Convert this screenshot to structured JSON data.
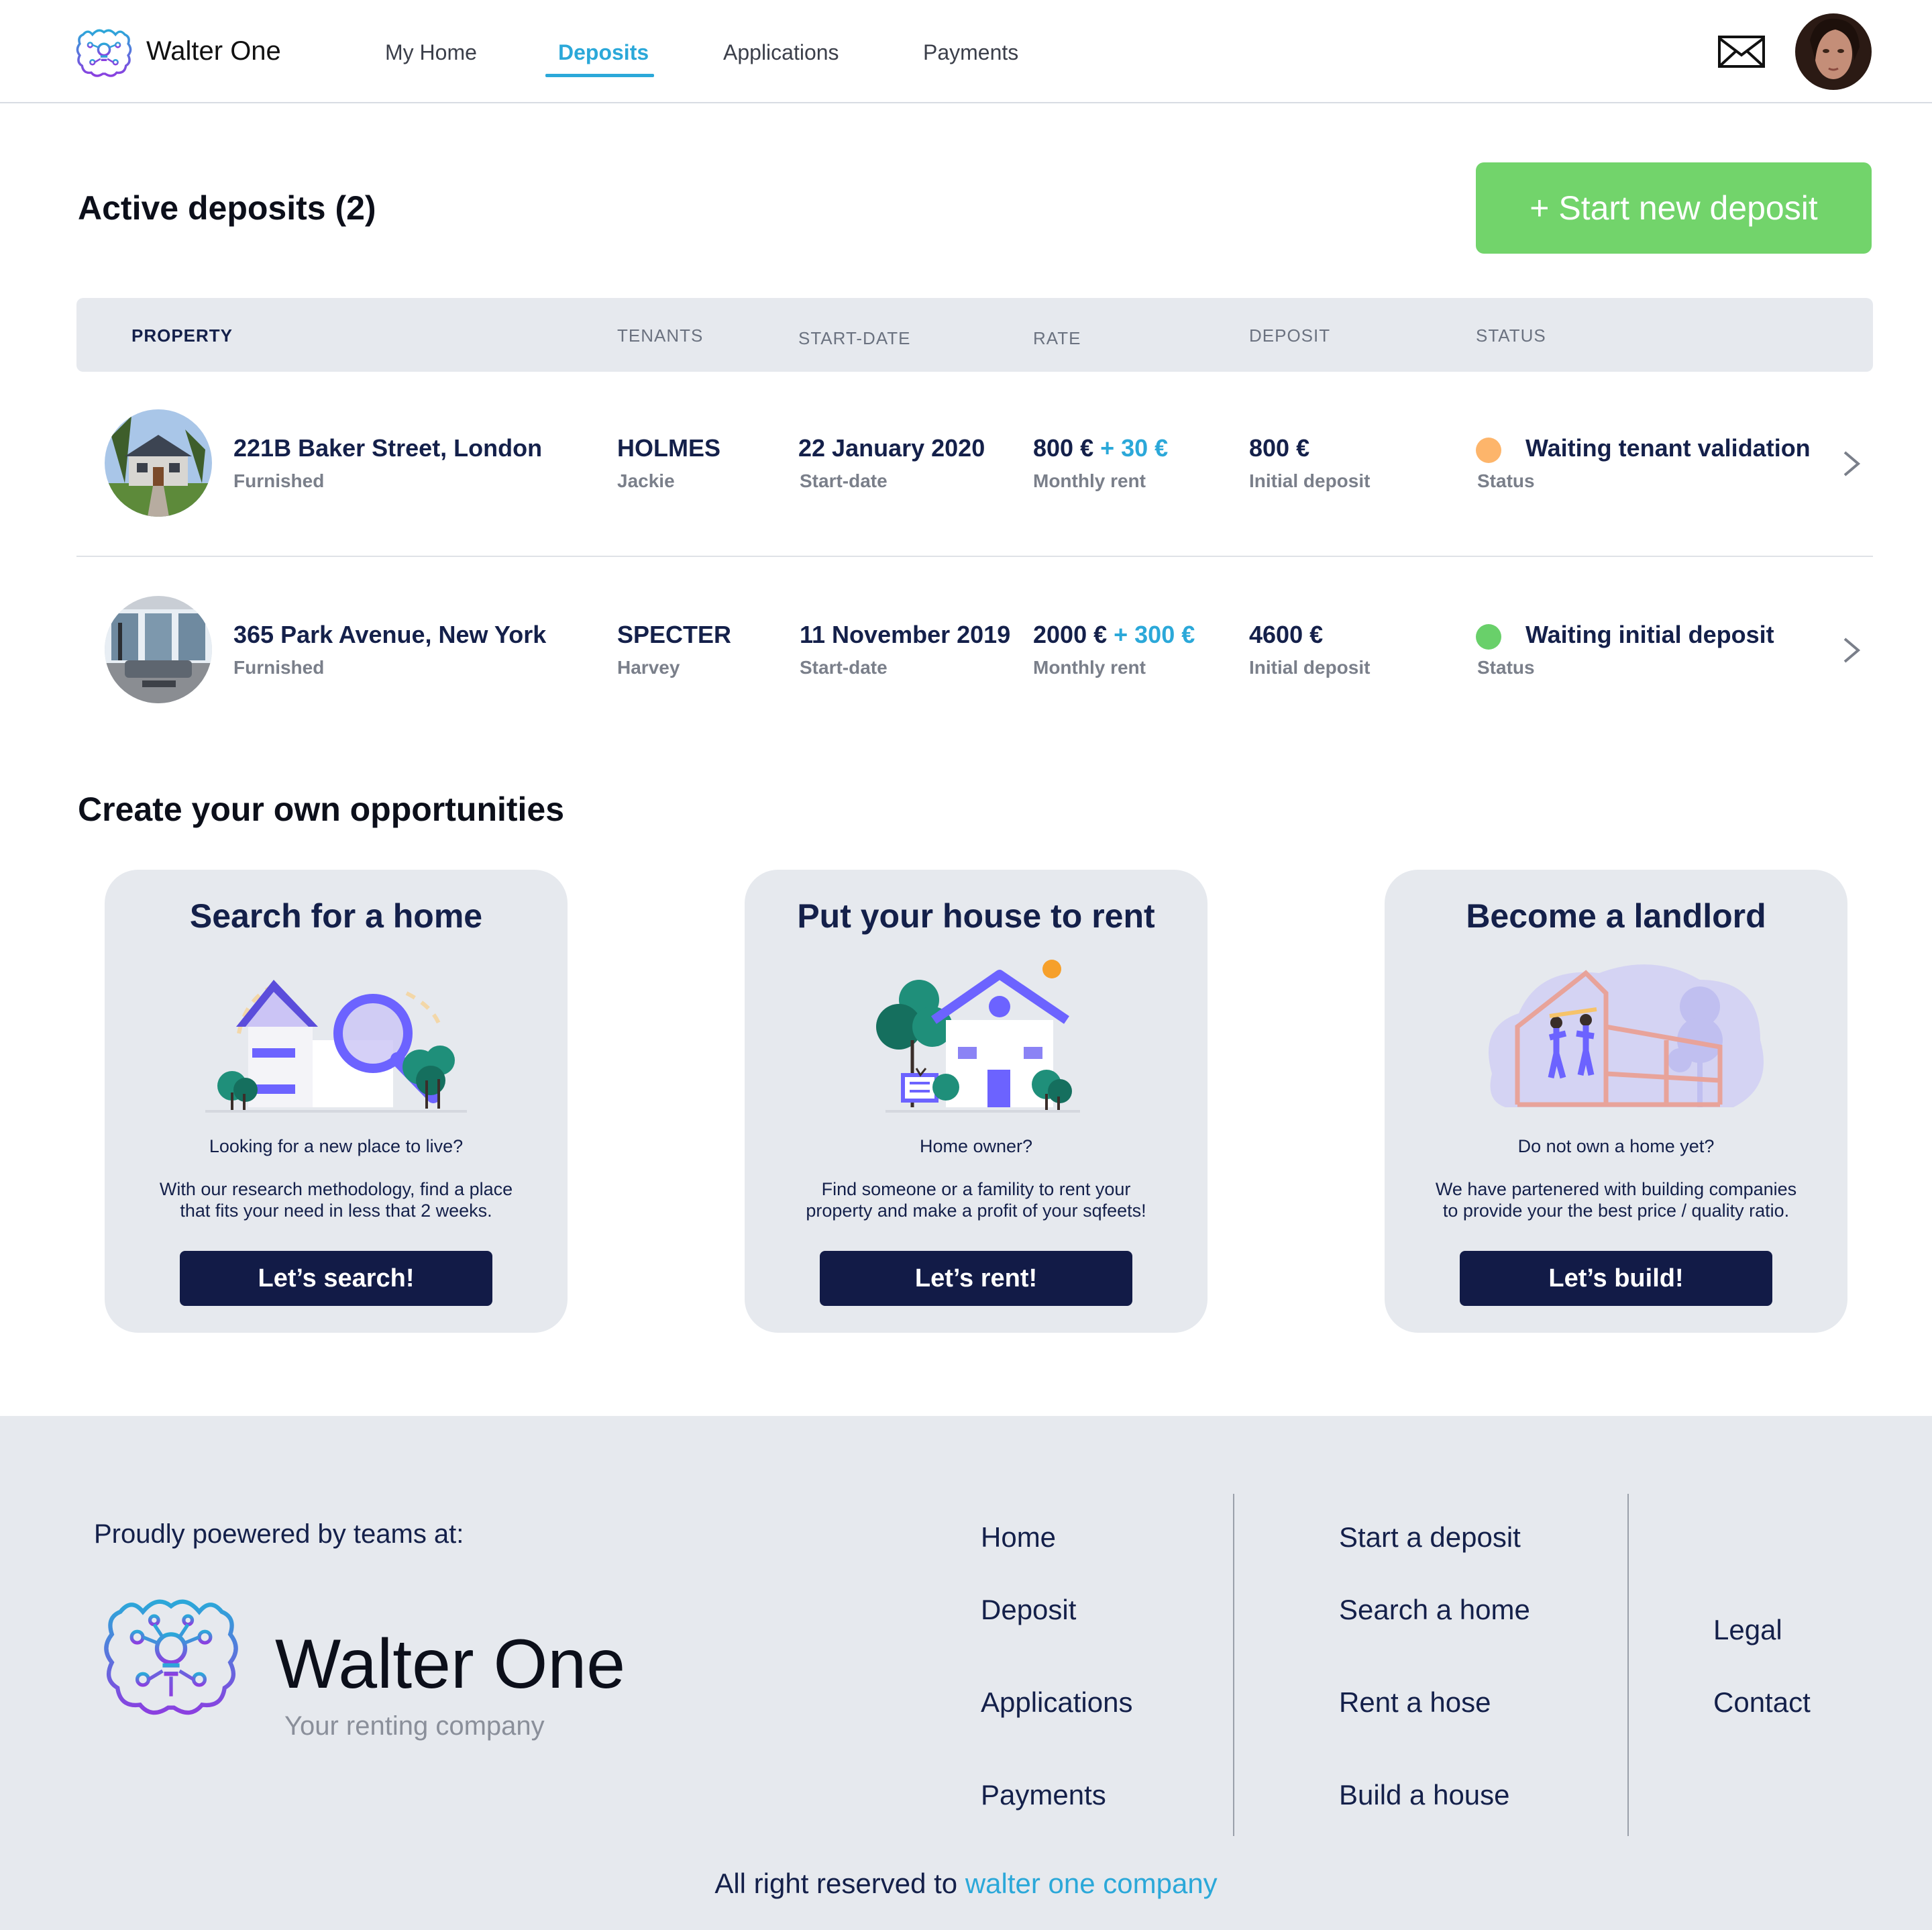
{
  "app": {
    "name": "Walter One"
  },
  "nav": {
    "tabs": [
      {
        "label": "My Home"
      },
      {
        "label": "Deposits",
        "active": true
      },
      {
        "label": "Applications"
      },
      {
        "label": "Payments"
      }
    ],
    "icons": {
      "mail": "envelope-icon",
      "avatar": "user-avatar"
    }
  },
  "deposits": {
    "title": "Active deposits (2)",
    "new_button": "+ Start new deposit",
    "columns": [
      "PROPERTY",
      "TENANTS",
      "START-DATE",
      "RATE",
      "DEPOSIT",
      "STATUS"
    ],
    "rows": [
      {
        "address": "221B Baker Street, London",
        "furnishing": "Furnished",
        "tenant_last": "HOLMES",
        "tenant_first": "Jackie",
        "start_date": "22 January 2020",
        "start_label": "Start-date",
        "rate": "800 €",
        "rate_extra": "+ 30 €",
        "rate_label": "Monthly rent",
        "deposit": "800 €",
        "deposit_label": "Initial deposit",
        "status": "Waiting tenant validation",
        "status_label": "Status",
        "status_color": "#fdb56b"
      },
      {
        "address": "365 Park Avenue, New York",
        "furnishing": "Furnished",
        "tenant_last": "SPECTER",
        "tenant_first": "Harvey",
        "start_date": "11 November 2019",
        "start_label": "Start-date",
        "rate": "2000 €",
        "rate_extra": "+ 300 €",
        "rate_label": "Monthly rent",
        "deposit": "4600 €",
        "deposit_label": "Initial deposit",
        "status": "Waiting initial deposit",
        "status_label": "Status",
        "status_color": "#69d06a"
      }
    ]
  },
  "opportunities": {
    "title": "Create your own opportunities",
    "cards": [
      {
        "title": "Search for a home",
        "question": "Looking for a new place to live?",
        "desc1": "With our research methodology, find a place",
        "desc2": "that fits your need in less that 2 weeks.",
        "button": "Let’s search!"
      },
      {
        "title": "Put your house to rent",
        "question": "Home owner?",
        "desc1": "Find someone or a famility to rent your",
        "desc2": "property and make a profit of your sqfeets!",
        "button": "Let’s rent!"
      },
      {
        "title": "Become a landlord",
        "question": "Do not own a home yet?",
        "desc1": "We have partenered with building companies",
        "desc2": "to provide your the best price / quality ratio.",
        "button": "Let’s build!"
      }
    ]
  },
  "footer": {
    "powered": "Proudly poewered by teams at:",
    "brand": "Walter One",
    "tagline": "Your renting company",
    "col1": [
      "Home",
      "Deposit",
      "Applications",
      "Payments"
    ],
    "col2": [
      "Start a deposit",
      "Search a home",
      "Rent a hose",
      "Build a house"
    ],
    "col3": [
      "Legal",
      "Contact"
    ],
    "copyright_prefix": "All right reserved to",
    "copyright_link": "walter one company"
  },
  "colors": {
    "accent": "#2ba8d9",
    "primary_dark": "#121b47",
    "success": "#72d46b",
    "brand_purple": "#6c63ff"
  }
}
